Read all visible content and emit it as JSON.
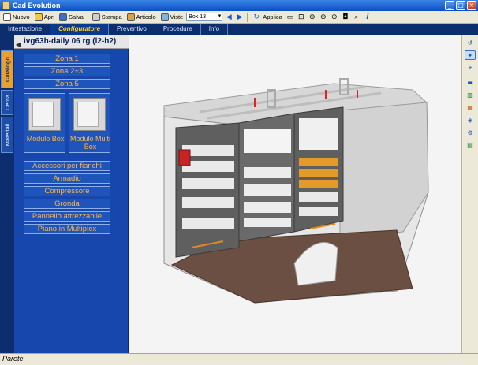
{
  "window": {
    "title": "Cad Evolution"
  },
  "toolbar": {
    "new_label": "Nuovo",
    "open_label": "Apri",
    "save_label": "Salva",
    "print_label": "Stampa",
    "article_label": "Articolo",
    "views_label": "Viste",
    "view_value": "Box 13",
    "apply_label": "Applica"
  },
  "tabs": [
    "Intestazione",
    "Configuratore",
    "Preventivo",
    "Procedure",
    "Info"
  ],
  "vtabs": [
    "Catalogo",
    "Cerca",
    "Materiali"
  ],
  "panel": {
    "title": "ivg63h-daily 06 rg (l2-h2)",
    "zones": [
      "Zona 1",
      "Zona 2+3",
      "Zona 5"
    ],
    "tiles": [
      "Modulo Box",
      "Modulo Multi Box"
    ],
    "items": [
      "Accessori per fianchi",
      "Armadio",
      "Compressore",
      "Gronda",
      "Pannello attrezzabile",
      "Piano in Multiplex"
    ]
  },
  "status": {
    "text": "Parete"
  },
  "colors": {
    "accent": "#ffb347",
    "panel": "#1747ad",
    "tab_active": "#ffd23a"
  }
}
